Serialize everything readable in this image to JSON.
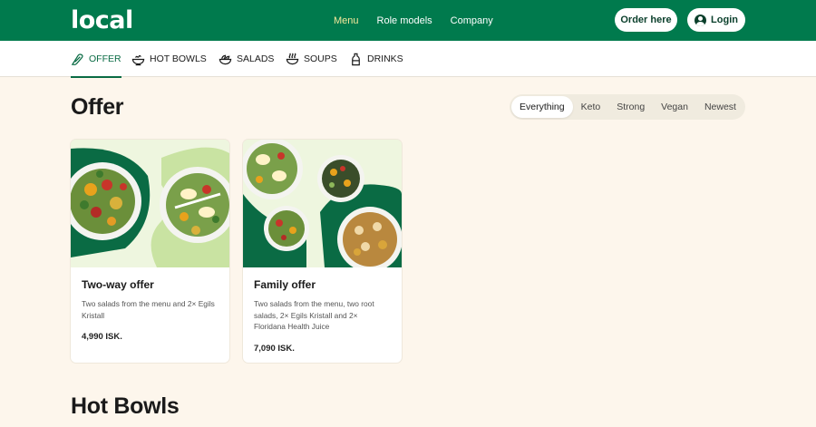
{
  "brand": {
    "name": "local"
  },
  "header": {
    "nav": [
      {
        "label": "Menu",
        "active": true
      },
      {
        "label": "Role models",
        "active": false
      },
      {
        "label": "Company",
        "active": false
      }
    ],
    "order_label": "Order here",
    "login_label": "Login"
  },
  "categories": [
    {
      "label": "OFFER",
      "icon": "tag-icon",
      "active": true
    },
    {
      "label": "HOT BOWLS",
      "icon": "bowl-icon",
      "active": false
    },
    {
      "label": "SALADS",
      "icon": "salad-icon",
      "active": false
    },
    {
      "label": "SOUPS",
      "icon": "soup-icon",
      "active": false
    },
    {
      "label": "DRINKS",
      "icon": "bottle-icon",
      "active": false
    }
  ],
  "offer": {
    "title": "Offer",
    "filters": [
      {
        "label": "Everything",
        "active": true
      },
      {
        "label": "Keto",
        "active": false
      },
      {
        "label": "Strong",
        "active": false
      },
      {
        "label": "Vegan",
        "active": false
      },
      {
        "label": "Newest",
        "active": false
      }
    ],
    "cards": [
      {
        "title": "Two-way offer",
        "description": "Two salads from the menu and 2× Egils Kristall",
        "price": "4,990 ISK."
      },
      {
        "title": "Family offer",
        "description": "Two salads from the menu, two root salads, 2× Egils Kristall and 2× Floridana Health Juice",
        "price": "7,090 ISK."
      }
    ]
  },
  "next_section": {
    "title": "Hot Bowls"
  },
  "colors": {
    "brand_green": "#007a4d",
    "active_menu": "#f3e79a",
    "background": "#fdf6ec"
  }
}
